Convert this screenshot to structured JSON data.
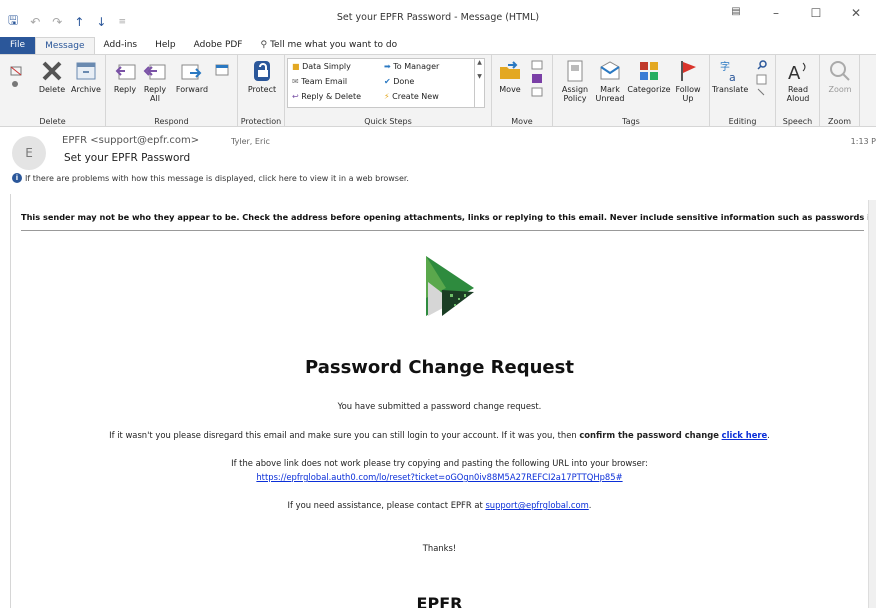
{
  "window": {
    "title": "Set your EPFR Password  -  Message (HTML)"
  },
  "tabs": [
    {
      "label": "File"
    },
    {
      "label": "Message"
    },
    {
      "label": "Add-ins"
    },
    {
      "label": "Help"
    },
    {
      "label": "Adobe PDF"
    },
    {
      "label": "Tell me what you want to do"
    }
  ],
  "ribbon": {
    "delete_group": {
      "label": "Delete",
      "delete": "Delete",
      "archive": "Archive"
    },
    "respond_group": {
      "label": "Respond",
      "reply": "Reply",
      "reply_all": "Reply All",
      "forward": "Forward"
    },
    "protection_group": {
      "label": "Protection",
      "protect": "Protect"
    },
    "quicksteps_group": {
      "label": "Quick Steps",
      "items": [
        "Data Simply",
        "To Manager",
        "Team Email",
        "Done",
        "Reply & Delete",
        "Create New"
      ]
    },
    "move_group": {
      "label": "Move",
      "move": "Move"
    },
    "tags_group": {
      "label": "Tags",
      "assign_policy": "Assign Policy",
      "mark_unread": "Mark Unread",
      "categorize": "Categorize",
      "follow_up": "Follow Up"
    },
    "editing_group": {
      "label": "Editing",
      "translate": "Translate"
    },
    "speech_group": {
      "label": "Speech",
      "read_aloud": "Read Aloud"
    },
    "zoom_group": {
      "label": "Zoom",
      "zoom": "Zoom"
    }
  },
  "header": {
    "avatar_initial": "E",
    "from": "EPFR <support@epfr.com>",
    "to": "Tyler, Eric",
    "subject": "Set your EPFR Password",
    "time": "1:13 P",
    "info": "If there are problems with how this message is displayed, click here to view it in a web browser."
  },
  "body": {
    "warning": "This sender may not be who they appear to be. Check the address before opening attachments, links or replying to this email. Never include sensitive information such as passwords in emails.",
    "heading": "Password Change Request",
    "line1": "You have submitted a password change request.",
    "line2_pre": "If it wasn't you please disregard this email and make sure you can still login to your account. If it was you, then ",
    "line2_bold": "confirm the password change",
    "line2_link": "click here",
    "line2_post": ".",
    "line3": "If the above link does not work please try copying and pasting the following URL into your browser:",
    "url": "https://epfrglobal.auth0.com/lo/reset?ticket=oGOgn0iv88M5A27REFCI2a17PTTQHp85#",
    "line4_pre": "If you need assistance, please contact EPFR at ",
    "support_email": "support@epfrglobal.com",
    "line4_post": ".",
    "thanks": "Thanks!",
    "signature": "EPFR"
  }
}
